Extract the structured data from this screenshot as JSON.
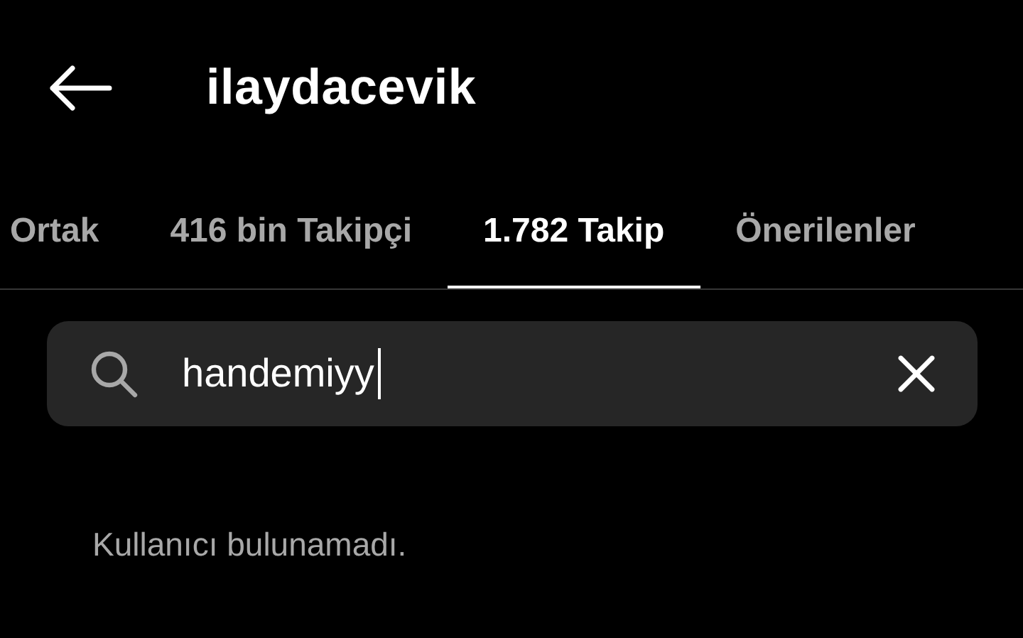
{
  "header": {
    "title": "ilaydacevik"
  },
  "tabs": [
    {
      "label": "Ortak",
      "selected": false
    },
    {
      "label": "416 bin Takipçi",
      "selected": false
    },
    {
      "label": "1.782 Takip",
      "selected": true
    },
    {
      "label": "Önerilenler",
      "selected": false
    }
  ],
  "search": {
    "value": "handemiyy",
    "focused": true
  },
  "message": "Kullanıcı bulunamadı."
}
